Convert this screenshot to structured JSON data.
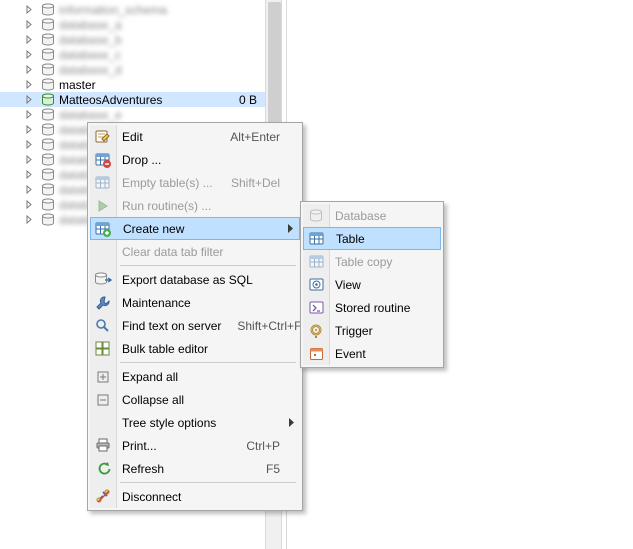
{
  "tree": {
    "items": [
      {
        "label": "information_schema",
        "blur": true,
        "icon": "db"
      },
      {
        "label": "database_a",
        "blur": true,
        "icon": "db"
      },
      {
        "label": "database_b",
        "blur": true,
        "icon": "db"
      },
      {
        "label": "database_c",
        "blur": true,
        "icon": "db"
      },
      {
        "label": "database_d",
        "blur": true,
        "icon": "db"
      },
      {
        "label": "master",
        "blur": false,
        "icon": "db"
      },
      {
        "label": "MatteosAdventures",
        "blur": false,
        "icon": "db-active",
        "selected": true,
        "size": "0 B"
      },
      {
        "label": "database_e",
        "blur": true,
        "icon": "db"
      },
      {
        "label": "database_f",
        "blur": true,
        "icon": "db"
      },
      {
        "label": "database_g",
        "blur": true,
        "icon": "db"
      },
      {
        "label": "database_h",
        "blur": true,
        "icon": "db"
      },
      {
        "label": "database_i",
        "blur": true,
        "icon": "db"
      },
      {
        "label": "database_j",
        "blur": true,
        "icon": "db"
      },
      {
        "label": "database_k",
        "blur": true,
        "icon": "db"
      },
      {
        "label": "database_l",
        "blur": true,
        "icon": "db"
      }
    ]
  },
  "menu": {
    "edit": {
      "label": "Edit",
      "accel": "Alt+Enter"
    },
    "drop": {
      "label": "Drop ..."
    },
    "empty": {
      "label": "Empty table(s) ...",
      "accel": "Shift+Del"
    },
    "run": {
      "label": "Run routine(s) ..."
    },
    "create": {
      "label": "Create new"
    },
    "clearfilter": {
      "label": "Clear data tab filter"
    },
    "export": {
      "label": "Export database as SQL"
    },
    "maint": {
      "label": "Maintenance"
    },
    "find": {
      "label": "Find text on server",
      "accel": "Shift+Ctrl+F"
    },
    "bulk": {
      "label": "Bulk table editor"
    },
    "expand": {
      "label": "Expand all"
    },
    "collapse": {
      "label": "Collapse all"
    },
    "treestyle": {
      "label": "Tree style options"
    },
    "print": {
      "label": "Print...",
      "accel": "Ctrl+P"
    },
    "refresh": {
      "label": "Refresh",
      "accel": "F5"
    },
    "disconnect": {
      "label": "Disconnect"
    }
  },
  "submenu": {
    "database": {
      "label": "Database"
    },
    "table": {
      "label": "Table"
    },
    "tablecopy": {
      "label": "Table copy"
    },
    "view": {
      "label": "View"
    },
    "routine": {
      "label": "Stored routine"
    },
    "trigger": {
      "label": "Trigger"
    },
    "event": {
      "label": "Event"
    }
  }
}
